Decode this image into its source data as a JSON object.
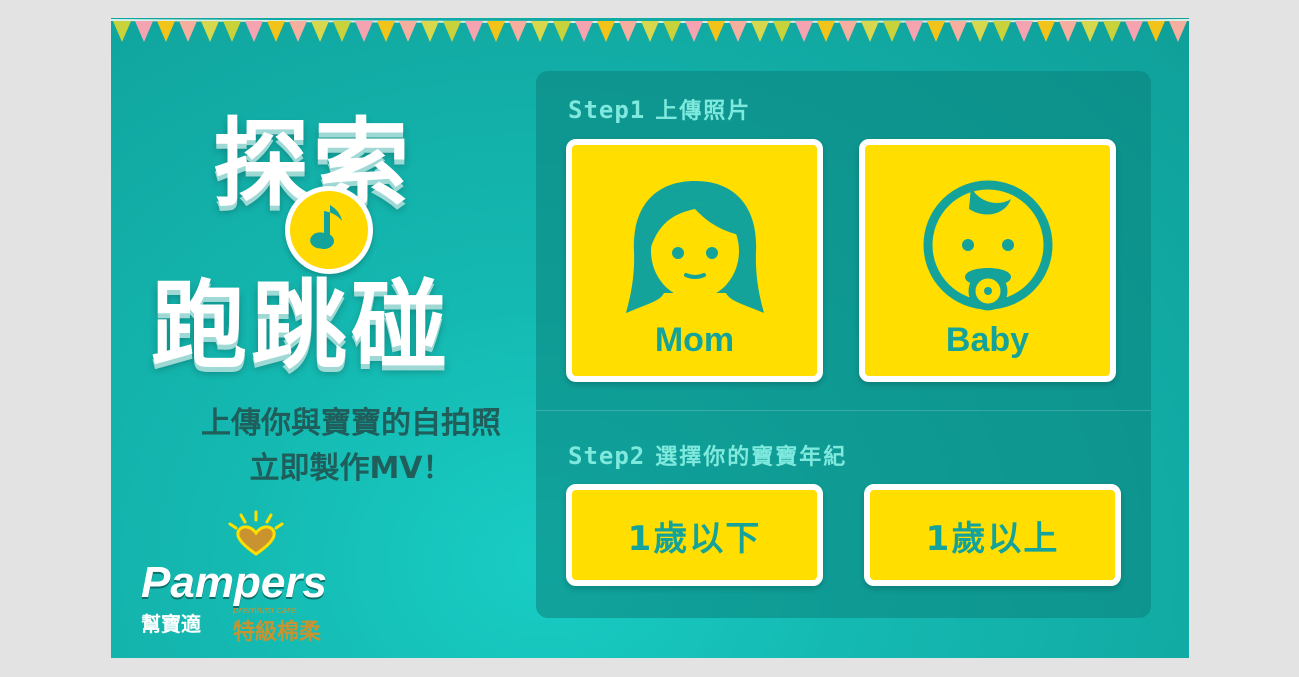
{
  "title": {
    "line1": "探索",
    "line2": "跑跳碰"
  },
  "tagline": {
    "line1": "上傳你與寶寶的自拍照",
    "line2": "立即製作MV！"
  },
  "brand": {
    "name": "Pampers",
    "chinese_name": "幫寶適",
    "sub_label": "premium care",
    "product_line": "特級棉柔"
  },
  "step1": {
    "label": "Step1",
    "description": "上傳照片",
    "options": [
      {
        "label": "Mom"
      },
      {
        "label": "Baby"
      }
    ]
  },
  "step2": {
    "label": "Step2",
    "description": "選擇你的寶寶年紀",
    "options": [
      {
        "label": "1歲以下"
      },
      {
        "label": "1歲以上"
      }
    ]
  },
  "colors": {
    "background": "#14b9b1",
    "accent_yellow": "#ffde00",
    "icon_teal": "#14a39b",
    "step_text": "#7fe9dd",
    "logo_gold": "#c9932f"
  }
}
